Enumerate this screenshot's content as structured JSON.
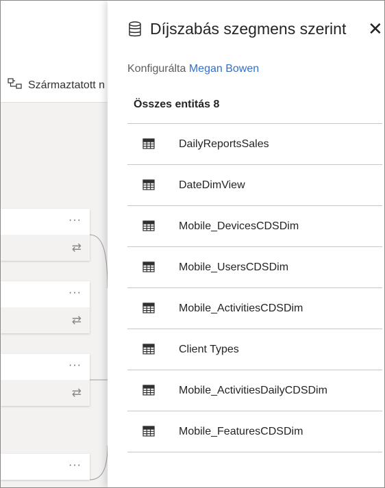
{
  "background": {
    "lineage_button": {
      "label": "Származtatott n",
      "icon": "lineage-icon"
    },
    "cards": [
      {
        "more": "···",
        "swap": "⇄"
      },
      {
        "more": "···",
        "swap": "⇄"
      },
      {
        "more": "···",
        "swap": "⇄"
      },
      {
        "more": "···"
      }
    ]
  },
  "panel": {
    "icon": "database-icon",
    "title": "Díjszabás szegmens szerint",
    "close_icon": "close-icon",
    "configured_by_prefix": "Konfigurálta",
    "configured_by_user": "Megan Bowen",
    "count_label": "Összes entitás 8",
    "entities": [
      {
        "name": "DailyReportsSales",
        "icon": "table-icon"
      },
      {
        "name": "DateDimView",
        "icon": "table-icon"
      },
      {
        "name": "Mobile_DevicesCDSDim",
        "icon": "table-icon"
      },
      {
        "name": "Mobile_UsersCDSDim",
        "icon": "table-icon"
      },
      {
        "name": "Mobile_ActivitiesCDSDim",
        "icon": "table-icon"
      },
      {
        "name": "Client Types",
        "icon": "table-icon"
      },
      {
        "name": "Mobile_ActivitiesDailyCDSDim",
        "icon": "table-icon"
      },
      {
        "name": "Mobile_FeaturesCDSDim",
        "icon": "table-icon"
      }
    ]
  },
  "colors": {
    "link": "#2f6fcf",
    "divider": "#c8c6c4",
    "canvas": "#f3f2f1"
  }
}
